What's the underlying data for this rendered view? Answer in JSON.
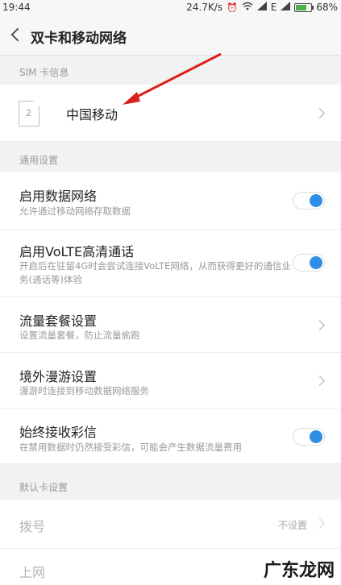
{
  "status_bar": {
    "time": "19:44",
    "net_speed": "24.7K/s",
    "network_type": "E",
    "battery": "68%",
    "battery_level": 0.68
  },
  "header": {
    "title": "双卡和移动网络"
  },
  "sim_section": {
    "header": "SIM 卡信息",
    "sim_slot_number": "2",
    "carrier": "中国移动"
  },
  "general_section": {
    "header": "通用设置",
    "items": [
      {
        "title": "启用数据网络",
        "subtitle": "允许通过移动网络存取数据",
        "toggle_on": true
      },
      {
        "title": "启用VoLTE高清通话",
        "subtitle": "开启后在驻留4G时会尝试连接VoLTE网络，从而获得更好的通信业务(通话等)体验",
        "toggle_on": true
      },
      {
        "title": "流量套餐设置",
        "subtitle": "设置流量套餐，防止流量偷跑"
      },
      {
        "title": "境外漫游设置",
        "subtitle": "漫游时连接到移动数据网络服务"
      },
      {
        "title": "始终接收彩信",
        "subtitle": "在禁用数据时仍然接受彩信，可能会产生数据流量费用",
        "toggle_on": true
      }
    ]
  },
  "default_section": {
    "header": "默认卡设置",
    "items": [
      {
        "title": "拨号",
        "value": "不设置"
      },
      {
        "title": "上网"
      }
    ]
  },
  "watermark": "广东龙网",
  "colors": {
    "accent": "#2f8ee6",
    "annotation_arrow": "#d9201f"
  }
}
